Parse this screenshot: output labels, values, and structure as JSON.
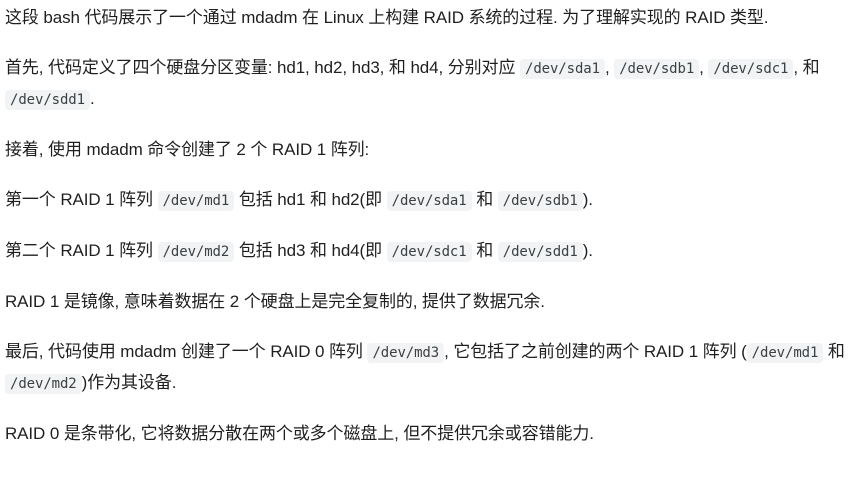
{
  "paragraphs": [
    [
      {
        "t": "text",
        "v": "这段 bash 代码展示了一个通过 mdadm 在 Linux 上构建 RAID 系统的过程. 为了理解实现的 RAID 类型."
      }
    ],
    [
      {
        "t": "text",
        "v": "首先, 代码定义了四个硬盘分区变量: hd1, hd2, hd3, 和 hd4, 分别对应 "
      },
      {
        "t": "code",
        "v": "/dev/sda1"
      },
      {
        "t": "text",
        "v": ", "
      },
      {
        "t": "code",
        "v": "/dev/sdb1"
      },
      {
        "t": "text",
        "v": ", "
      },
      {
        "t": "code",
        "v": "/dev/sdc1"
      },
      {
        "t": "text",
        "v": ", 和 "
      },
      {
        "t": "code",
        "v": "/dev/sdd1"
      },
      {
        "t": "text",
        "v": "."
      }
    ],
    [
      {
        "t": "text",
        "v": "接着, 使用 mdadm 命令创建了 2 个 RAID 1 阵列:"
      }
    ],
    [
      {
        "t": "text",
        "v": "第一个 RAID 1 阵列 "
      },
      {
        "t": "code",
        "v": "/dev/md1"
      },
      {
        "t": "text",
        "v": " 包括 hd1 和 hd2(即 "
      },
      {
        "t": "code",
        "v": "/dev/sda1"
      },
      {
        "t": "text",
        "v": " 和 "
      },
      {
        "t": "code",
        "v": "/dev/sdb1"
      },
      {
        "t": "text",
        "v": ")."
      }
    ],
    [
      {
        "t": "text",
        "v": "第二个 RAID 1 阵列 "
      },
      {
        "t": "code",
        "v": "/dev/md2"
      },
      {
        "t": "text",
        "v": " 包括 hd3 和 hd4(即 "
      },
      {
        "t": "code",
        "v": "/dev/sdc1"
      },
      {
        "t": "text",
        "v": " 和 "
      },
      {
        "t": "code",
        "v": "/dev/sdd1"
      },
      {
        "t": "text",
        "v": ")."
      }
    ],
    [
      {
        "t": "text",
        "v": "RAID 1 是镜像, 意味着数据在 2 个硬盘上是完全复制的, 提供了数据冗余."
      }
    ],
    [
      {
        "t": "text",
        "v": "最后, 代码使用 mdadm 创建了一个 RAID 0 阵列 "
      },
      {
        "t": "code",
        "v": "/dev/md3"
      },
      {
        "t": "text",
        "v": ", 它包括了之前创建的两个 RAID 1 阵列 ("
      },
      {
        "t": "code",
        "v": "/dev/md1"
      },
      {
        "t": "text",
        "v": " 和 "
      },
      {
        "t": "code",
        "v": "/dev/md2"
      },
      {
        "t": "text",
        "v": ")作为其设备."
      }
    ],
    [
      {
        "t": "text",
        "v": "RAID 0 是条带化, 它将数据分散在两个或多个磁盘上, 但不提供冗余或容错能力."
      }
    ]
  ]
}
